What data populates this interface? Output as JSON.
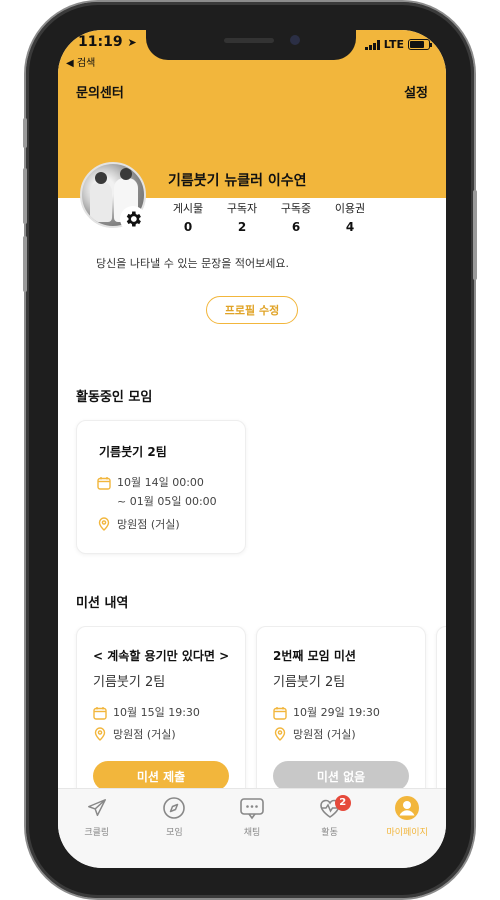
{
  "status_bar": {
    "time": "11:19",
    "back_label": "◀ 검색",
    "network": "LTE",
    "battery_level": 0.8
  },
  "nav": {
    "left": "문의센터",
    "right": "설정"
  },
  "profile": {
    "name": "기름붓기 뉴클러 이수연",
    "stats": [
      {
        "label": "게시물",
        "value": "0"
      },
      {
        "label": "구독자",
        "value": "2"
      },
      {
        "label": "구독중",
        "value": "6"
      },
      {
        "label": "이용권",
        "value": "4"
      }
    ],
    "bio_placeholder": "당신을 나타낼 수 있는 문장을 적어보세요.",
    "edit_button": "프로필 수정"
  },
  "active_groups": {
    "title": "활동중인 모임",
    "items": [
      {
        "name": "기름붓기 2팀",
        "date_start": "10월 14일 00:00",
        "date_end": "~ 01월 05일 00:00",
        "location": "망원점 (거실)"
      }
    ]
  },
  "missions": {
    "title": "미션 내역",
    "items": [
      {
        "title": "< 계속할 용기만 있다면 >",
        "team": "기름붓기 2팀",
        "date": "10월 15일 19:30",
        "location": "망원점 (거실)",
        "button": "미션 제출",
        "button_color": "#f2b63c"
      },
      {
        "title": "2번째 모임 미션",
        "team": "기름붓기 2팀",
        "date": "10월 29일 19:30",
        "location": "망원점 (거실)",
        "button": "미션 없음",
        "button_color": "#c8c8c8"
      }
    ]
  },
  "tabbar": {
    "tabs": [
      {
        "label": "크클링",
        "icon": "paper-plane-icon"
      },
      {
        "label": "모임",
        "icon": "compass-icon"
      },
      {
        "label": "채팅",
        "icon": "chat-bubble-icon"
      },
      {
        "label": "활동",
        "icon": "heartbeat-icon",
        "badge": "2"
      },
      {
        "label": "마이페이지",
        "icon": "user-icon",
        "active": true
      }
    ]
  },
  "colors": {
    "accent": "#f2b63c",
    "badge": "#e64a3b"
  }
}
